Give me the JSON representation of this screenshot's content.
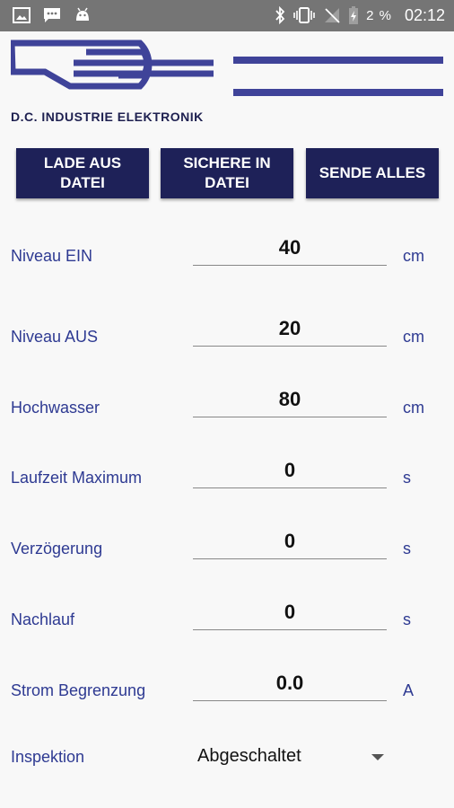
{
  "status_bar": {
    "time": "02:12",
    "battery_percent": "2 %",
    "icons": [
      "image-icon",
      "chat-icon",
      "android-icon",
      "bluetooth-icon",
      "vibrate-icon",
      "no-signal-icon",
      "battery-charging-icon"
    ]
  },
  "header": {
    "brand": "D.C. INDUSTRIE ELEKTRONIK",
    "logo_color": "#3f4399"
  },
  "buttons": {
    "load": "LADE AUS\nDATEI",
    "save": "SICHERE IN\nDATEI",
    "send": "SENDE ALLES"
  },
  "fields": [
    {
      "label": "Niveau EIN",
      "value": "40",
      "unit": "cm"
    },
    {
      "label": "Niveau AUS",
      "value": "20",
      "unit": "cm"
    },
    {
      "label": "Hochwasser",
      "value": "80",
      "unit": "cm"
    },
    {
      "label": "Laufzeit Maximum",
      "value": "0",
      "unit": "s"
    },
    {
      "label": "Verzögerung",
      "value": "0",
      "unit": "s"
    },
    {
      "label": "Nachlauf",
      "value": "0",
      "unit": "s"
    },
    {
      "label": "Strom Begrenzung",
      "value": "0.0",
      "unit": "A"
    }
  ],
  "inspection": {
    "label": "Inspektion",
    "selected": "Abgeschaltet"
  },
  "colors": {
    "button_bg": "#1e2158",
    "label_text": "#2e3a92",
    "status_bar": "#757575"
  }
}
